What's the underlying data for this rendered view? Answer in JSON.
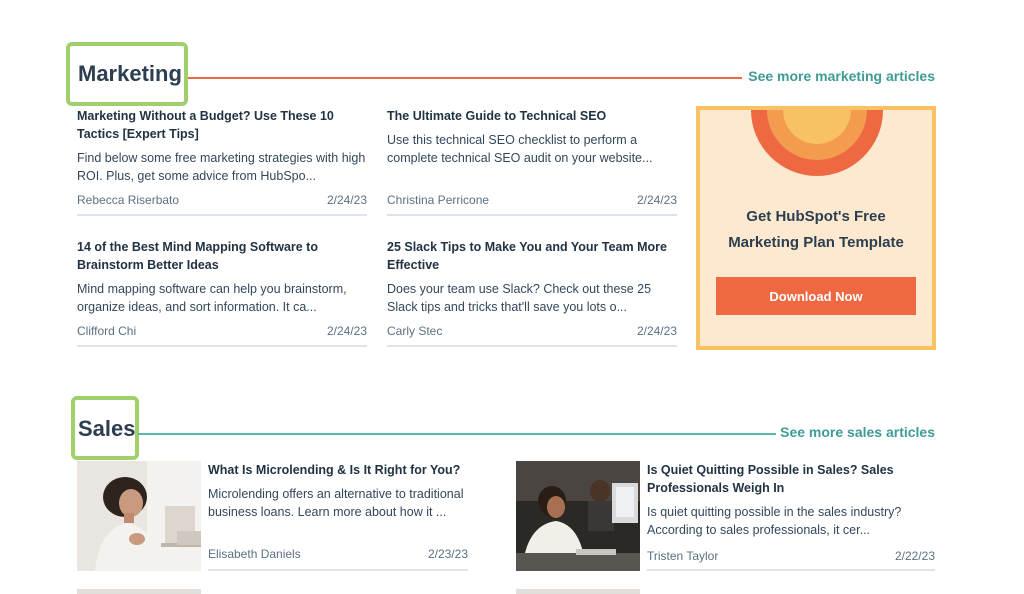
{
  "marketing": {
    "title": "Marketing",
    "see_more": "See more marketing articles",
    "articles": [
      {
        "title": "Marketing Without a Budget? Use These 10 Tactics [Expert Tips]",
        "description": "Find below some free marketing strategies with high ROI. Plus, get some advice from HubSpo...",
        "author": "Rebecca Riserbato",
        "date": "2/24/23"
      },
      {
        "title": "The Ultimate Guide to Technical SEO",
        "description": "Use this technical SEO checklist to perform a complete technical SEO audit on your website...",
        "author": "Christina Perricone",
        "date": "2/24/23"
      },
      {
        "title": "14 of the Best Mind Mapping Software to Brainstorm Better Ideas",
        "description": "Mind mapping software can help you brainstorm, organize ideas, and sort information. It ca...",
        "author": "Clifford Chi",
        "date": "2/24/23"
      },
      {
        "title": "25 Slack Tips to Make You and Your Team More Effective",
        "description": "Does your team use Slack? Check out these 25 Slack tips and tricks that'll save you lots o...",
        "author": "Carly Stec",
        "date": "2/24/23"
      }
    ],
    "promo": {
      "title_line1": "Get HubSpot's Free",
      "title_line2": "Marketing Plan Template",
      "button": "Download Now"
    }
  },
  "sales": {
    "title": "Sales",
    "see_more": "See more sales articles",
    "articles": [
      {
        "title": "What Is Microlending & Is It Right for You?",
        "description": "Microlending offers an alternative to traditional business loans. Learn more about how it ...",
        "author": "Elisabeth Daniels",
        "date": "2/23/23",
        "image_icon": "woman-smiling-at-laptop-photo"
      },
      {
        "title": "Is Quiet Quitting Possible in Sales? Sales Professionals Weigh In",
        "description": "Is quiet quitting possible in the sales industry? According to sales professionals, it cer...",
        "author": "Tristen Taylor",
        "date": "2/22/23",
        "image_icon": "office-workers-at-computers-photo"
      }
    ]
  },
  "colors": {
    "marketing_line": "#ee6841",
    "sales_line": "#58b8b0",
    "link": "#3e9b95",
    "highlight_box": "#9fd06b",
    "promo_bg": "#fde9cf",
    "promo_border": "#f8c162",
    "button": "#ee6841"
  }
}
